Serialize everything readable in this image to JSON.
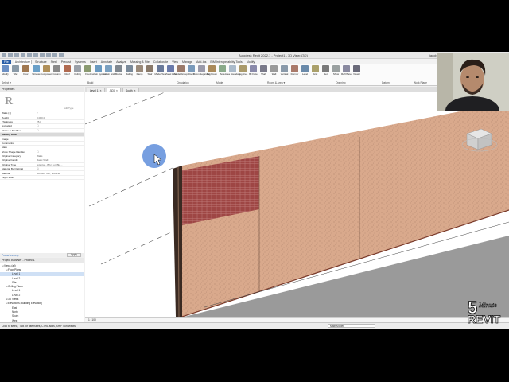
{
  "app": {
    "title": "Autodesk Revit 2022.1 - Project1 - 3D View: {3D}",
    "user": "jacobbennet"
  },
  "ribbon": {
    "tabs": [
      "File",
      "Architecture",
      "Structure",
      "Steel",
      "Precast",
      "Systems",
      "Insert",
      "Annotate",
      "Analyze",
      "Massing & Site",
      "Collaborate",
      "View",
      "Manage",
      "Add-Ins",
      "BIM Interoperability Tools",
      "Modify"
    ],
    "active_tab": "Architecture",
    "tools": [
      "Modify",
      "Wall",
      "Door",
      "Window",
      "Component",
      "Column",
      "Roof",
      "Ceiling",
      "Floor",
      "Curtain System",
      "Curtain Grid",
      "Mullion",
      "Railing",
      "Ramp",
      "Stair",
      "Model Text",
      "Model Line",
      "Model Group",
      "Room",
      "Room Separator",
      "Tag Room",
      "Area",
      "Area Boundary",
      "Tag Area",
      "By Face",
      "Shaft",
      "Wall",
      "Vertical",
      "Dormer",
      "Level",
      "Grid",
      "Set",
      "Show",
      "Ref Plane",
      "Viewer"
    ],
    "panels": [
      "Select ▾",
      "Build",
      "Circulation",
      "Model",
      "Room & Area ▾",
      "Opening",
      "Datum",
      "Work Plane"
    ]
  },
  "properties": {
    "header": "Properties",
    "edit_type": "Edit Type",
    "type_filter": "Walls (1)",
    "rows": [
      {
        "k": "Height",
        "v": "3,000.0"
      },
      {
        "k": "Thickness",
        "v": "25.0"
      },
      {
        "k": "Excluded",
        "v": "☐"
      },
      {
        "k": "Shape is Modified",
        "v": "☐"
      },
      {
        "k": "Identity Data",
        "v": "",
        "section": true
      },
      {
        "k": "Image",
        "v": ""
      },
      {
        "k": "Comments",
        "v": ""
      },
      {
        "k": "Mark",
        "v": ""
      },
      {
        "k": "Show Shape Handles",
        "v": "☐"
      },
      {
        "k": "Original Category",
        "v": "Walls"
      },
      {
        "k": "Original Family",
        "v": "Basic Wall"
      },
      {
        "k": "Original Type",
        "v": "Exterior - Brick on Blo..."
      },
      {
        "k": "Material By Original",
        "v": "☑"
      },
      {
        "k": "Material",
        "v": "Render, Tan, Textured"
      },
      {
        "k": "Layer Index",
        "v": ""
      }
    ],
    "help_link": "Properties help",
    "apply": "Apply"
  },
  "browser": {
    "header": "Project Browser - Project1",
    "items": [
      {
        "label": "Views (all)",
        "depth": 0,
        "tw": "⊟"
      },
      {
        "label": "Floor Plans",
        "depth": 1,
        "tw": "⊟"
      },
      {
        "label": "Level 1",
        "depth": 2,
        "tw": "",
        "selected": true
      },
      {
        "label": "Level 2",
        "depth": 2,
        "tw": ""
      },
      {
        "label": "Site",
        "depth": 2,
        "tw": ""
      },
      {
        "label": "Ceiling Plans",
        "depth": 1,
        "tw": "⊟"
      },
      {
        "label": "Level 1",
        "depth": 2,
        "tw": ""
      },
      {
        "label": "Level 2",
        "depth": 2,
        "tw": ""
      },
      {
        "label": "3D Views",
        "depth": 1,
        "tw": "⊞"
      },
      {
        "label": "Elevations (Building Elevation)",
        "depth": 1,
        "tw": "⊟"
      },
      {
        "label": "East",
        "depth": 2,
        "tw": ""
      },
      {
        "label": "North",
        "depth": 2,
        "tw": ""
      },
      {
        "label": "South",
        "depth": 2,
        "tw": ""
      },
      {
        "label": "West",
        "depth": 2,
        "tw": ""
      },
      {
        "label": "Legends",
        "depth": 0,
        "tw": "⊞"
      },
      {
        "label": "Schedules/Quantities (all)",
        "depth": 0,
        "tw": "⊞"
      },
      {
        "label": "Sheets (all)",
        "depth": 0,
        "tw": "⊞"
      },
      {
        "label": "Families",
        "depth": 0,
        "tw": "⊞"
      },
      {
        "label": "Groups",
        "depth": 0,
        "tw": "⊞"
      },
      {
        "label": "Revit Links",
        "depth": 0,
        "tw": "⊞"
      }
    ]
  },
  "viewtabs": [
    {
      "label": "Level 1",
      "active": false
    },
    {
      "label": "{3D}",
      "active": true
    },
    {
      "label": "South",
      "active": false
    }
  ],
  "viewbar": {
    "scale": "1 : 100"
  },
  "status": {
    "text": "Click to select, TAB for alternates, CTRL adds, SHIFT unselects.",
    "model": "Main Model"
  },
  "logo": {
    "number": "5",
    "word1": "Minute",
    "word2": "REVIT"
  },
  "colors": {
    "brick": "#9e4644",
    "render": "#d9a98c",
    "floor": "#9a9a9a",
    "wall_edge": "#3a2a22",
    "file_tab": "#2a5ea8",
    "cursor_highlight": "#4a7fd6"
  }
}
